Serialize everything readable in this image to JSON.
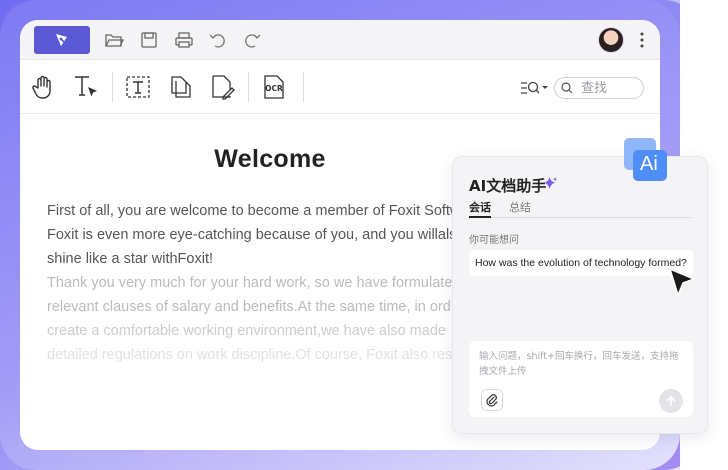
{
  "document": {
    "title": "Welcome",
    "paragraph1_lines": [
      "First of all, you are welcome to become a member of Foxit Softw",
      "Foxit is even more eye-catching because of you, and you willals",
      "shine like a star withFoxit!"
    ],
    "paragraph2_lines": [
      "Thank you very much for your hard work, so we have formulate",
      "relevant clauses of salary and benefits.At the same time, in ord",
      "create a comfortable working environment,we have also made",
      "detailed regulations on work discipline.Of course, Foxit also res"
    ]
  },
  "toolbar": {
    "search_placeholder": "查找"
  },
  "ai_panel": {
    "badge_label": "Ai",
    "title": "AI文档助手",
    "tabs": [
      "会话",
      "总结"
    ],
    "suggestion_label": "你可能想问",
    "suggested_question": "How was the evolution of technology formed?",
    "input_placeholder": "输入问题，shift+回车换行，回车发送，支持拖拽文件上传"
  },
  "colors": {
    "brand": "#5b59d6",
    "frame": "#7b78f4",
    "ai_badge": "#4f8ef7"
  }
}
